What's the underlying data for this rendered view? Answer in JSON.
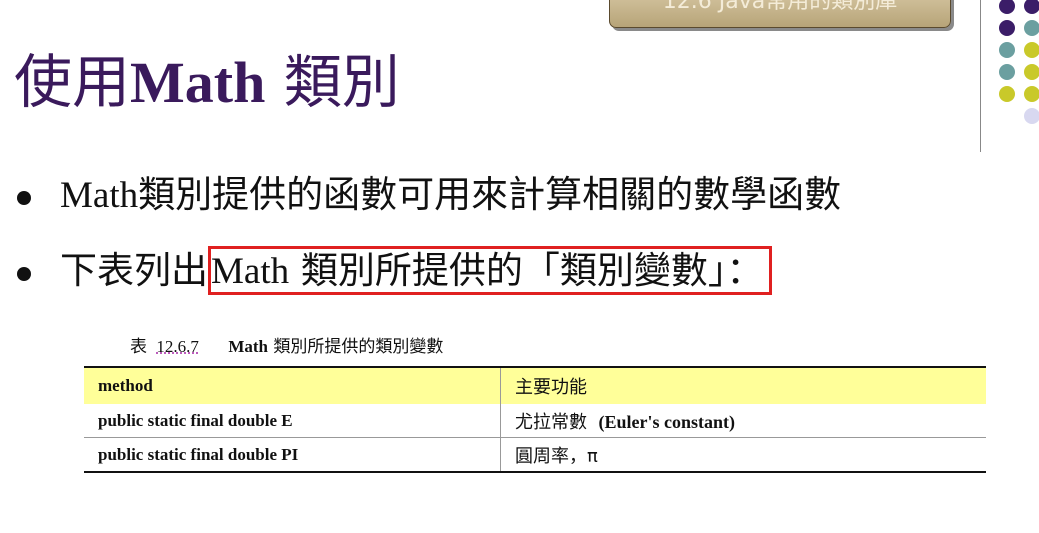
{
  "header": {
    "tab_label": "12.6 Java常用的類別庫"
  },
  "decoration": {
    "dot_colors": [
      "#3b1d68",
      "#6b9fa0",
      "#c9c92a",
      "#d8d8f0"
    ]
  },
  "title": {
    "prefix": "使用",
    "math": "Math",
    "suffix": " 類別"
  },
  "bullets": {
    "first": {
      "math": "Math",
      "rest": "類別提供的函數可用來計算相關的數學函數"
    },
    "second": {
      "lead": "下表列出",
      "hl_math": "Math",
      "hl_rest": " 類別所提供的「類別變數」："
    }
  },
  "table": {
    "caption": {
      "label": "表",
      "number": "12.6.7",
      "math": "Math",
      "rest": " 類別所提供的類別變數"
    },
    "headers": {
      "method": "method",
      "function": "主要功能"
    },
    "rows": [
      {
        "method": "public static final double E",
        "desc_cn": "尤拉常數",
        "desc_en": "(Euler's constant)"
      },
      {
        "method": "public static final double PI",
        "desc_cn": "圓周率，π",
        "desc_en": ""
      }
    ]
  }
}
